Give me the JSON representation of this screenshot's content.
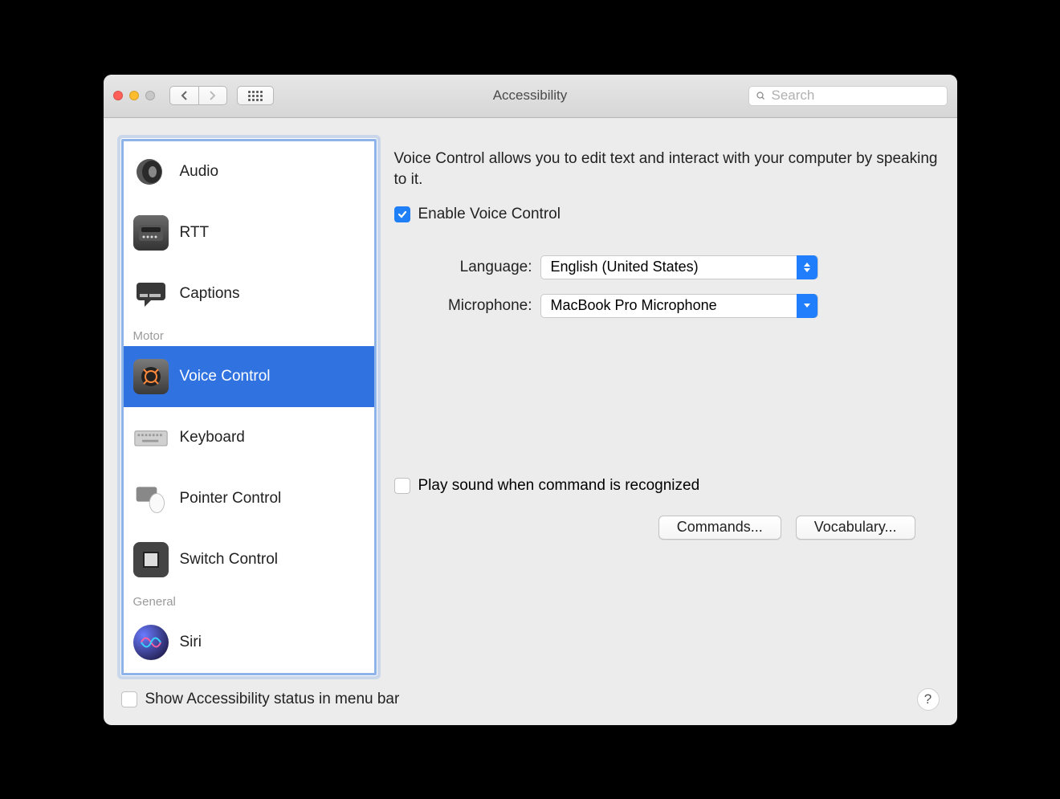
{
  "window": {
    "title": "Accessibility",
    "search_placeholder": "Search"
  },
  "sidebar": {
    "group_motor": "Motor",
    "group_general": "General",
    "items": [
      {
        "label": "Audio"
      },
      {
        "label": "RTT"
      },
      {
        "label": "Captions"
      },
      {
        "label": "Voice Control"
      },
      {
        "label": "Keyboard"
      },
      {
        "label": "Pointer Control"
      },
      {
        "label": "Switch Control"
      },
      {
        "label": "Siri"
      }
    ]
  },
  "main": {
    "description": "Voice Control allows you to edit text and interact with your computer by speaking to it.",
    "enable_label": "Enable Voice Control",
    "enable_checked": true,
    "language_label": "Language:",
    "language_value": "English (United States)",
    "microphone_label": "Microphone:",
    "microphone_value": "MacBook Pro Microphone",
    "play_sound_label": "Play sound when command is recognized",
    "play_sound_checked": false,
    "commands_button": "Commands...",
    "vocabulary_button": "Vocabulary..."
  },
  "footer": {
    "menubar_label": "Show Accessibility status in menu bar",
    "menubar_checked": false
  }
}
